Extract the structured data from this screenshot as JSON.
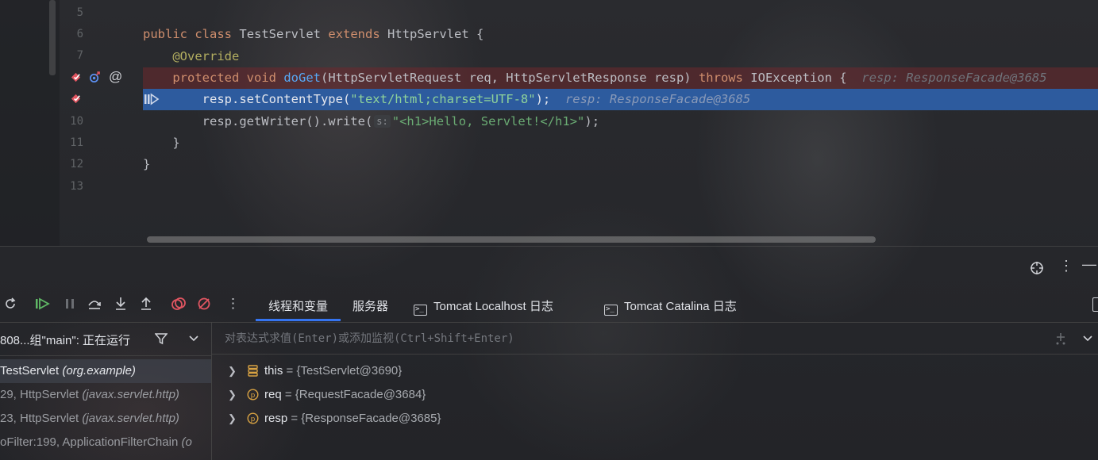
{
  "editor": {
    "line_numbers": [
      "5",
      "6",
      "7",
      "8",
      "9",
      "10",
      "11",
      "12",
      "13"
    ],
    "lines": {
      "l6": {
        "kw1": "public",
        "kw2": "class",
        "name": "TestServlet",
        "kw3": "extends",
        "base": "HttpServlet {"
      },
      "l7": {
        "ann": "@Override"
      },
      "l8": {
        "kw1": "protected",
        "kw2": "void",
        "fn": "doGet",
        "params": "(HttpServletRequest req, HttpServletResponse resp)",
        "kw3": "throws",
        "rest": "IOException {",
        "hint": "resp: ResponseFacade@3685"
      },
      "l9": {
        "code1": "resp.setContentType(",
        "str": "\"text/html;charset=UTF-8\"",
        "code2": ");",
        "hint": "resp: ResponseFacade@3685"
      },
      "l10": {
        "code1": "resp.getWriter().write(",
        "param_hint": "s:",
        "str": "\"<h1>Hello, Servlet!</h1>\"",
        "code2": ");"
      },
      "l11": {
        "code": "}"
      },
      "l12": {
        "code": "}"
      }
    }
  },
  "toolbar": {
    "tabs": [
      "线程和变量",
      "服务器",
      "Tomcat Localhost 日志",
      "Tomcat Catalina 日志"
    ]
  },
  "frames": {
    "thread_label": "808...组\"main\": 正在运行",
    "rows": [
      {
        "method": "TestServlet",
        "pkg": "(org.example)"
      },
      {
        "method": "29, HttpServlet",
        "pkg": "(javax.servlet.http)"
      },
      {
        "method": "23, HttpServlet",
        "pkg": "(javax.servlet.http)"
      },
      {
        "method": "oFilter:199, ApplicationFilterChain",
        "pkg": "(o"
      }
    ]
  },
  "watch": {
    "placeholder": "对表达式求值(Enter)或添加监视(Ctrl+Shift+Enter)"
  },
  "variables": [
    {
      "name": "this",
      "eq": " = ",
      "value": "{TestServlet@3690}"
    },
    {
      "name": "req",
      "eq": " = ",
      "value": "{RequestFacade@3684}"
    },
    {
      "name": "resp",
      "eq": " = ",
      "value": "{ResponseFacade@3685}"
    }
  ],
  "colors": {
    "accent": "#3574f0",
    "exec_line": "#2d5b9e",
    "breakpoint": "#e05561"
  }
}
